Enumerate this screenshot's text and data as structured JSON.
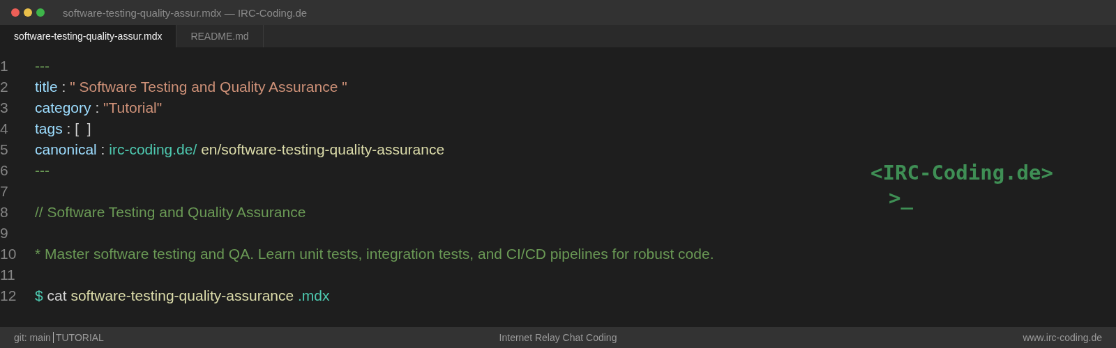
{
  "window": {
    "title": "software-testing-quality-assur.mdx — IRC-Coding.de"
  },
  "tabs": [
    {
      "label": "software-testing-quality-assur.mdx",
      "selected": true
    },
    {
      "label": "README.md",
      "selected": false
    }
  ],
  "editor": {
    "lines": [
      {
        "number": "1",
        "segments": [
          {
            "kind": "rule",
            "text": "---"
          }
        ]
      },
      {
        "number": "2",
        "segments": [
          {
            "kind": "key",
            "text": "title"
          },
          {
            "kind": "punct",
            "text": " : "
          },
          {
            "kind": "string",
            "text": "\" Software Testing and Quality Assurance \""
          }
        ]
      },
      {
        "number": "3",
        "segments": [
          {
            "kind": "key",
            "text": "category"
          },
          {
            "kind": "punct",
            "text": " : "
          },
          {
            "kind": "string",
            "text": "\"Tutorial\""
          }
        ]
      },
      {
        "number": "4",
        "segments": [
          {
            "kind": "key",
            "text": "tags"
          },
          {
            "kind": "punct",
            "text": " : [  ]"
          }
        ]
      },
      {
        "number": "5",
        "segments": [
          {
            "kind": "key",
            "text": "canonical"
          },
          {
            "kind": "punct",
            "text": " : "
          },
          {
            "kind": "link",
            "text": "irc-coding.de/"
          },
          {
            "kind": "value",
            "text": " en/software-testing-quality-assurance"
          }
        ]
      },
      {
        "number": "6",
        "segments": [
          {
            "kind": "rule",
            "text": "---"
          }
        ]
      },
      {
        "number": "7"
      },
      {
        "number": "8",
        "segments": [
          {
            "kind": "comment",
            "text": "// Software Testing and Quality Assurance"
          }
        ]
      },
      {
        "number": "9"
      },
      {
        "number": "10",
        "segments": [
          {
            "kind": "comment",
            "text": "* Master software testing and QA. Learn unit tests, integration tests, and CI/CD pipelines for robust code."
          }
        ]
      },
      {
        "number": "11"
      },
      {
        "number": "12",
        "segments": [
          {
            "kind": "prompt",
            "text": "$"
          },
          {
            "kind": "punct",
            "text": " cat "
          },
          {
            "kind": "value",
            "text": "software-testing-quality-assurance"
          },
          {
            "kind": "link",
            "text": " .mdx"
          }
        ]
      }
    ]
  },
  "logo": {
    "name": "<IRC-Coding.de>",
    "prompt": ">_"
  },
  "status_bar": {
    "branch": "git: main",
    "mode": "TUTORIAL",
    "center": "Internet Relay Chat Coding",
    "right": "www.irc-coding.de"
  }
}
